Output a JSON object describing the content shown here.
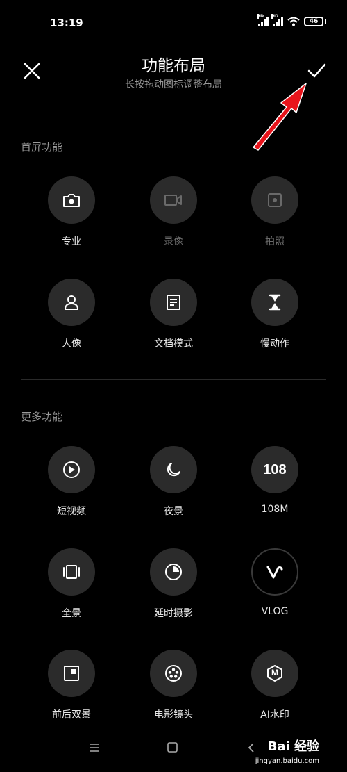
{
  "status": {
    "time": "13:19",
    "battery": "46",
    "hd1": "HD",
    "hd2": "HD"
  },
  "header": {
    "title": "功能布局",
    "subtitle": "长按拖动图标调整布局"
  },
  "sections": {
    "home": {
      "title": "首屏功能"
    },
    "more": {
      "title": "更多功能"
    }
  },
  "home_items": [
    {
      "label": "专业",
      "icon": "camera-icon"
    },
    {
      "label": "录像",
      "icon": "video-icon",
      "disabled": true
    },
    {
      "label": "拍照",
      "icon": "photo-icon",
      "disabled": true
    },
    {
      "label": "人像",
      "icon": "person-icon"
    },
    {
      "label": "文档模式",
      "icon": "document-icon"
    },
    {
      "label": "慢动作",
      "icon": "hourglass-icon"
    }
  ],
  "more_items": [
    {
      "label": "短视频",
      "icon": "play-icon"
    },
    {
      "label": "夜景",
      "icon": "moon-icon"
    },
    {
      "label": "108M",
      "icon": "108-icon",
      "icon_text": "108"
    },
    {
      "label": "全景",
      "icon": "panorama-icon"
    },
    {
      "label": "延时摄影",
      "icon": "timer-icon"
    },
    {
      "label": "VLOG",
      "icon": "vlog-icon"
    },
    {
      "label": "前后双景",
      "icon": "dual-view-icon"
    },
    {
      "label": "电影镜头",
      "icon": "film-reel-icon"
    },
    {
      "label": "AI水印",
      "icon": "ai-watermark-icon",
      "icon_text": "M"
    }
  ],
  "watermark": {
    "text": "Bai 经验",
    "url": "jingyan.baidu.com"
  },
  "colors": {
    "background": "#000000",
    "circle": "#2b2b2b",
    "annotation_arrow": "#e8141b"
  }
}
